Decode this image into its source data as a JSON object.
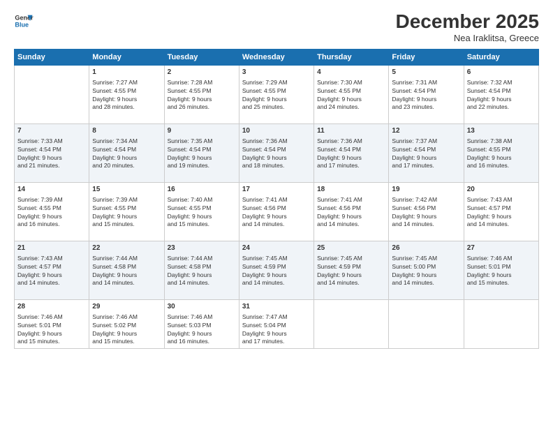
{
  "logo": {
    "line1": "General",
    "line2": "Blue"
  },
  "title": "December 2025",
  "subtitle": "Nea Iraklitsa, Greece",
  "headers": [
    "Sunday",
    "Monday",
    "Tuesday",
    "Wednesday",
    "Thursday",
    "Friday",
    "Saturday"
  ],
  "weeks": [
    [
      {
        "day": "",
        "info": ""
      },
      {
        "day": "1",
        "info": "Sunrise: 7:27 AM\nSunset: 4:55 PM\nDaylight: 9 hours\nand 28 minutes."
      },
      {
        "day": "2",
        "info": "Sunrise: 7:28 AM\nSunset: 4:55 PM\nDaylight: 9 hours\nand 26 minutes."
      },
      {
        "day": "3",
        "info": "Sunrise: 7:29 AM\nSunset: 4:55 PM\nDaylight: 9 hours\nand 25 minutes."
      },
      {
        "day": "4",
        "info": "Sunrise: 7:30 AM\nSunset: 4:55 PM\nDaylight: 9 hours\nand 24 minutes."
      },
      {
        "day": "5",
        "info": "Sunrise: 7:31 AM\nSunset: 4:54 PM\nDaylight: 9 hours\nand 23 minutes."
      },
      {
        "day": "6",
        "info": "Sunrise: 7:32 AM\nSunset: 4:54 PM\nDaylight: 9 hours\nand 22 minutes."
      }
    ],
    [
      {
        "day": "7",
        "info": "Sunrise: 7:33 AM\nSunset: 4:54 PM\nDaylight: 9 hours\nand 21 minutes."
      },
      {
        "day": "8",
        "info": "Sunrise: 7:34 AM\nSunset: 4:54 PM\nDaylight: 9 hours\nand 20 minutes."
      },
      {
        "day": "9",
        "info": "Sunrise: 7:35 AM\nSunset: 4:54 PM\nDaylight: 9 hours\nand 19 minutes."
      },
      {
        "day": "10",
        "info": "Sunrise: 7:36 AM\nSunset: 4:54 PM\nDaylight: 9 hours\nand 18 minutes."
      },
      {
        "day": "11",
        "info": "Sunrise: 7:36 AM\nSunset: 4:54 PM\nDaylight: 9 hours\nand 17 minutes."
      },
      {
        "day": "12",
        "info": "Sunrise: 7:37 AM\nSunset: 4:54 PM\nDaylight: 9 hours\nand 17 minutes."
      },
      {
        "day": "13",
        "info": "Sunrise: 7:38 AM\nSunset: 4:55 PM\nDaylight: 9 hours\nand 16 minutes."
      }
    ],
    [
      {
        "day": "14",
        "info": "Sunrise: 7:39 AM\nSunset: 4:55 PM\nDaylight: 9 hours\nand 16 minutes."
      },
      {
        "day": "15",
        "info": "Sunrise: 7:39 AM\nSunset: 4:55 PM\nDaylight: 9 hours\nand 15 minutes."
      },
      {
        "day": "16",
        "info": "Sunrise: 7:40 AM\nSunset: 4:55 PM\nDaylight: 9 hours\nand 15 minutes."
      },
      {
        "day": "17",
        "info": "Sunrise: 7:41 AM\nSunset: 4:56 PM\nDaylight: 9 hours\nand 14 minutes."
      },
      {
        "day": "18",
        "info": "Sunrise: 7:41 AM\nSunset: 4:56 PM\nDaylight: 9 hours\nand 14 minutes."
      },
      {
        "day": "19",
        "info": "Sunrise: 7:42 AM\nSunset: 4:56 PM\nDaylight: 9 hours\nand 14 minutes."
      },
      {
        "day": "20",
        "info": "Sunrise: 7:43 AM\nSunset: 4:57 PM\nDaylight: 9 hours\nand 14 minutes."
      }
    ],
    [
      {
        "day": "21",
        "info": "Sunrise: 7:43 AM\nSunset: 4:57 PM\nDaylight: 9 hours\nand 14 minutes."
      },
      {
        "day": "22",
        "info": "Sunrise: 7:44 AM\nSunset: 4:58 PM\nDaylight: 9 hours\nand 14 minutes."
      },
      {
        "day": "23",
        "info": "Sunrise: 7:44 AM\nSunset: 4:58 PM\nDaylight: 9 hours\nand 14 minutes."
      },
      {
        "day": "24",
        "info": "Sunrise: 7:45 AM\nSunset: 4:59 PM\nDaylight: 9 hours\nand 14 minutes."
      },
      {
        "day": "25",
        "info": "Sunrise: 7:45 AM\nSunset: 4:59 PM\nDaylight: 9 hours\nand 14 minutes."
      },
      {
        "day": "26",
        "info": "Sunrise: 7:45 AM\nSunset: 5:00 PM\nDaylight: 9 hours\nand 14 minutes."
      },
      {
        "day": "27",
        "info": "Sunrise: 7:46 AM\nSunset: 5:01 PM\nDaylight: 9 hours\nand 15 minutes."
      }
    ],
    [
      {
        "day": "28",
        "info": "Sunrise: 7:46 AM\nSunset: 5:01 PM\nDaylight: 9 hours\nand 15 minutes."
      },
      {
        "day": "29",
        "info": "Sunrise: 7:46 AM\nSunset: 5:02 PM\nDaylight: 9 hours\nand 15 minutes."
      },
      {
        "day": "30",
        "info": "Sunrise: 7:46 AM\nSunset: 5:03 PM\nDaylight: 9 hours\nand 16 minutes."
      },
      {
        "day": "31",
        "info": "Sunrise: 7:47 AM\nSunset: 5:04 PM\nDaylight: 9 hours\nand 17 minutes."
      },
      {
        "day": "",
        "info": ""
      },
      {
        "day": "",
        "info": ""
      },
      {
        "day": "",
        "info": ""
      }
    ]
  ]
}
